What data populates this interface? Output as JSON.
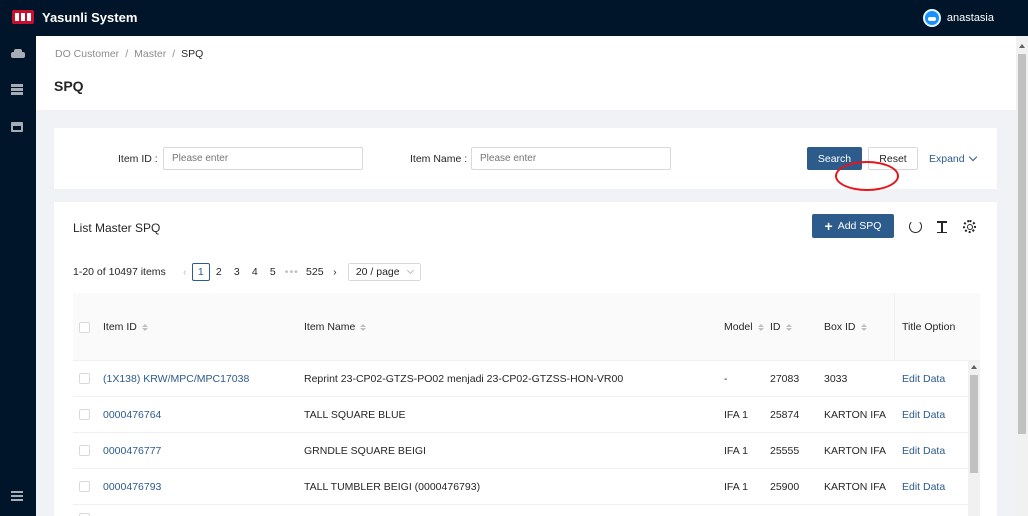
{
  "app": {
    "title": "Yasunli System",
    "user_name": "anastasia"
  },
  "breadcrumb": [
    "DO Customer",
    "/",
    "Master",
    "/",
    "SPQ"
  ],
  "page_title": "SPQ",
  "search": {
    "item_id_label": "Item ID :",
    "item_id_placeholder": "Please enter",
    "item_name_label": "Item Name :",
    "item_name_placeholder": "Please enter",
    "search_label": "Search",
    "reset_label": "Reset",
    "expand_label": "Expand"
  },
  "list": {
    "title": "List Master SPQ",
    "add_label": "Add SPQ",
    "total_text": "1-20 of 10497 items",
    "pages": [
      "1",
      "2",
      "3",
      "4",
      "5"
    ],
    "ellipsis": "•••",
    "last_page": "525",
    "page_size": "20 / page",
    "columns": [
      "Item ID",
      "Item Name",
      "Model",
      "ID",
      "Box ID",
      "Title Option"
    ],
    "rows": [
      {
        "item_id": "(1X138) KRW/MPC/MPC17038",
        "item_name": "Reprint 23-CP02-GTZS-PO02 menjadi 23-CP02-GTZSS-HON-VR00",
        "model": "-",
        "id": "27083",
        "box_id": "3033",
        "action": "Edit Data"
      },
      {
        "item_id": "0000476764",
        "item_name": "TALL SQUARE BLUE",
        "model": "IFA 1",
        "id": "25874",
        "box_id": "KARTON IFA",
        "action": "Edit Data"
      },
      {
        "item_id": "0000476777",
        "item_name": "GRNDLE SQUARE BEIGI",
        "model": "IFA 1",
        "id": "25555",
        "box_id": "KARTON IFA",
        "action": "Edit Data"
      },
      {
        "item_id": "0000476793",
        "item_name": "TALL TUMBLER BEIGI (0000476793)",
        "model": "IFA 1",
        "id": "25900",
        "box_id": "KARTON IFA",
        "action": "Edit Data"
      }
    ]
  },
  "colors": {
    "topbar": "#001529",
    "primary": "#2d5b8c",
    "annotation": "#e8141b"
  }
}
